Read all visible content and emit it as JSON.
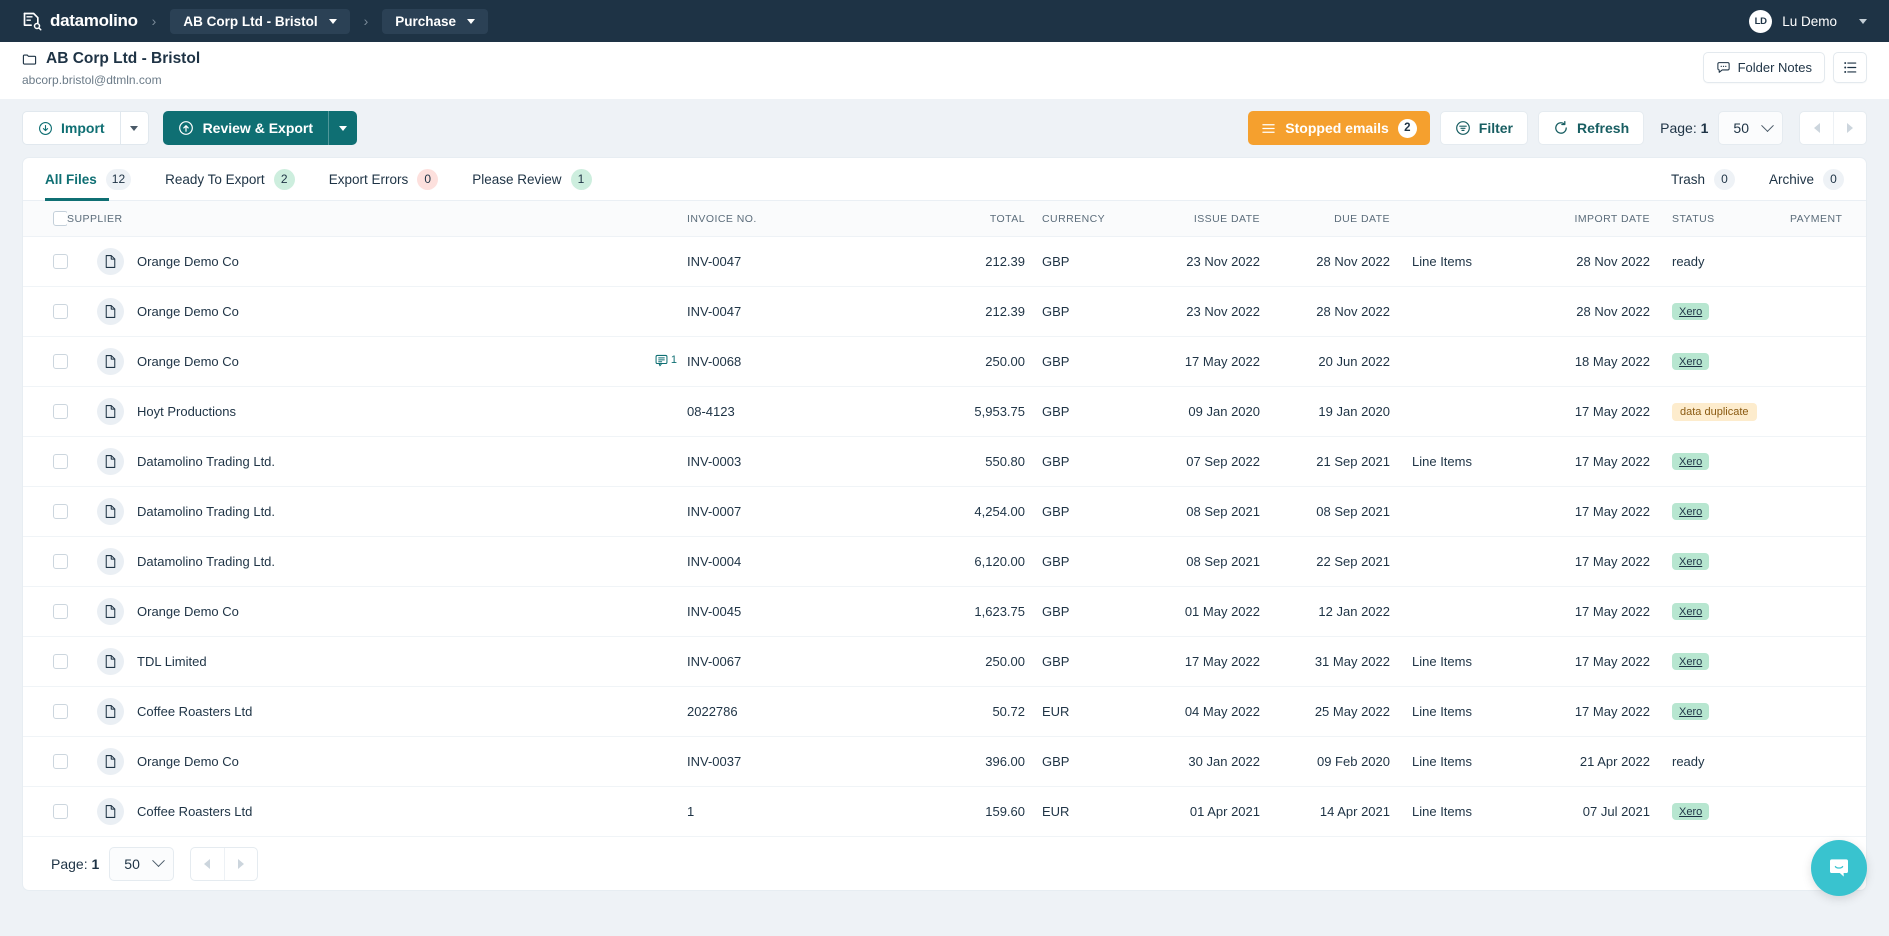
{
  "topnav": {
    "brand": "datamolino",
    "breadcrumbs": [
      {
        "label": "AB Corp Ltd - Bristol"
      },
      {
        "label": "Purchase"
      }
    ],
    "user": {
      "initials": "LD",
      "name": "Lu Demo"
    }
  },
  "folder": {
    "title": "AB Corp Ltd - Bristol",
    "email": "abcorp.bristol@dtmln.com",
    "notes_label": "Folder Notes"
  },
  "toolbar": {
    "import_label": "Import",
    "export_label": "Review & Export",
    "stopped_emails_label": "Stopped emails",
    "stopped_emails_count": "2",
    "filter_label": "Filter",
    "refresh_label": "Refresh",
    "page_label": "Page:",
    "page_value": "1",
    "page_size": "50"
  },
  "tabs": [
    {
      "label": "All Files",
      "count": "12",
      "tone": "grey",
      "active": true
    },
    {
      "label": "Ready To Export",
      "count": "2",
      "tone": "green",
      "active": false
    },
    {
      "label": "Export Errors",
      "count": "0",
      "tone": "red",
      "active": false
    },
    {
      "label": "Please Review",
      "count": "1",
      "tone": "green",
      "active": false
    }
  ],
  "tabs_right": [
    {
      "label": "Trash",
      "count": "0",
      "tone": "grey"
    },
    {
      "label": "Archive",
      "count": "0",
      "tone": "grey"
    }
  ],
  "table": {
    "columns": [
      "SUPPLIER",
      "INVOICE NO.",
      "TOTAL",
      "CURRENCY",
      "ISSUE DATE",
      "DUE DATE",
      "IMPORT DATE",
      "STATUS",
      "PAYMENT"
    ],
    "line_items_label": "Line Items",
    "rows": [
      {
        "supplier": "Orange Demo Co",
        "notes": "",
        "invoice": "INV-0047",
        "total": "212.39",
        "currency": "GBP",
        "issue": "23 Nov 2022",
        "due": "28 Nov 2022",
        "line_items": true,
        "import": "28 Nov 2022",
        "status": "ready",
        "status_type": "plain",
        "payment": ""
      },
      {
        "supplier": "Orange Demo Co",
        "notes": "",
        "invoice": "INV-0047",
        "total": "212.39",
        "currency": "GBP",
        "issue": "23 Nov 2022",
        "due": "28 Nov 2022",
        "line_items": false,
        "import": "28 Nov 2022",
        "status": "Xero",
        "status_type": "xero",
        "payment": ""
      },
      {
        "supplier": "Orange Demo Co",
        "notes": "1",
        "invoice": "INV-0068",
        "total": "250.00",
        "currency": "GBP",
        "issue": "17 May 2022",
        "due": "20 Jun 2022",
        "line_items": false,
        "import": "18 May 2022",
        "status": "Xero",
        "status_type": "xero",
        "payment": ""
      },
      {
        "supplier": "Hoyt Productions",
        "notes": "",
        "invoice": "08-4123",
        "total": "5,953.75",
        "currency": "GBP",
        "issue": "09 Jan 2020",
        "due": "19 Jan 2020",
        "line_items": false,
        "import": "17 May 2022",
        "status": "data duplicate",
        "status_type": "dup",
        "payment": ""
      },
      {
        "supplier": "Datamolino Trading Ltd.",
        "notes": "",
        "invoice": "INV-0003",
        "total": "550.80",
        "currency": "GBP",
        "issue": "07 Sep 2022",
        "due": "21 Sep 2021",
        "line_items": true,
        "import": "17 May 2022",
        "status": "Xero",
        "status_type": "xero",
        "payment": ""
      },
      {
        "supplier": "Datamolino Trading Ltd.",
        "notes": "",
        "invoice": "INV-0007",
        "total": "4,254.00",
        "currency": "GBP",
        "issue": "08 Sep 2021",
        "due": "08 Sep 2021",
        "line_items": false,
        "import": "17 May 2022",
        "status": "Xero",
        "status_type": "xero",
        "payment": ""
      },
      {
        "supplier": "Datamolino Trading Ltd.",
        "notes": "",
        "invoice": "INV-0004",
        "total": "6,120.00",
        "currency": "GBP",
        "issue": "08 Sep 2021",
        "due": "22 Sep 2021",
        "line_items": false,
        "import": "17 May 2022",
        "status": "Xero",
        "status_type": "xero",
        "payment": ""
      },
      {
        "supplier": "Orange Demo Co",
        "notes": "",
        "invoice": "INV-0045",
        "total": "1,623.75",
        "currency": "GBP",
        "issue": "01 May 2022",
        "due": "12 Jan 2022",
        "line_items": false,
        "import": "17 May 2022",
        "status": "Xero",
        "status_type": "xero",
        "payment": ""
      },
      {
        "supplier": "TDL Limited",
        "notes": "",
        "invoice": "INV-0067",
        "total": "250.00",
        "currency": "GBP",
        "issue": "17 May 2022",
        "due": "31 May 2022",
        "line_items": true,
        "import": "17 May 2022",
        "status": "Xero",
        "status_type": "xero",
        "payment": ""
      },
      {
        "supplier": "Coffee Roasters Ltd",
        "notes": "",
        "invoice": "2022786",
        "total": "50.72",
        "currency": "EUR",
        "issue": "04 May 2022",
        "due": "25 May 2022",
        "line_items": true,
        "import": "17 May 2022",
        "status": "Xero",
        "status_type": "xero",
        "payment": ""
      },
      {
        "supplier": "Orange Demo Co",
        "notes": "",
        "invoice": "INV-0037",
        "total": "396.00",
        "currency": "GBP",
        "issue": "30 Jan 2022",
        "due": "09 Feb 2020",
        "line_items": true,
        "import": "21 Apr 2022",
        "status": "ready",
        "status_type": "plain",
        "payment": ""
      },
      {
        "supplier": "Coffee Roasters Ltd",
        "notes": "",
        "invoice": "1",
        "total": "159.60",
        "currency": "EUR",
        "issue": "01 Apr 2021",
        "due": "14 Apr 2021",
        "line_items": true,
        "import": "07 Jul 2021",
        "status": "Xero",
        "status_type": "xero",
        "payment": ""
      }
    ]
  },
  "footer": {
    "page_label": "Page:",
    "page_value": "1",
    "page_size": "50"
  },
  "colors": {
    "nav": "#1e3345",
    "accent": "#0f6f73",
    "warning": "#f5a02e",
    "chat": "#39c3cf"
  }
}
